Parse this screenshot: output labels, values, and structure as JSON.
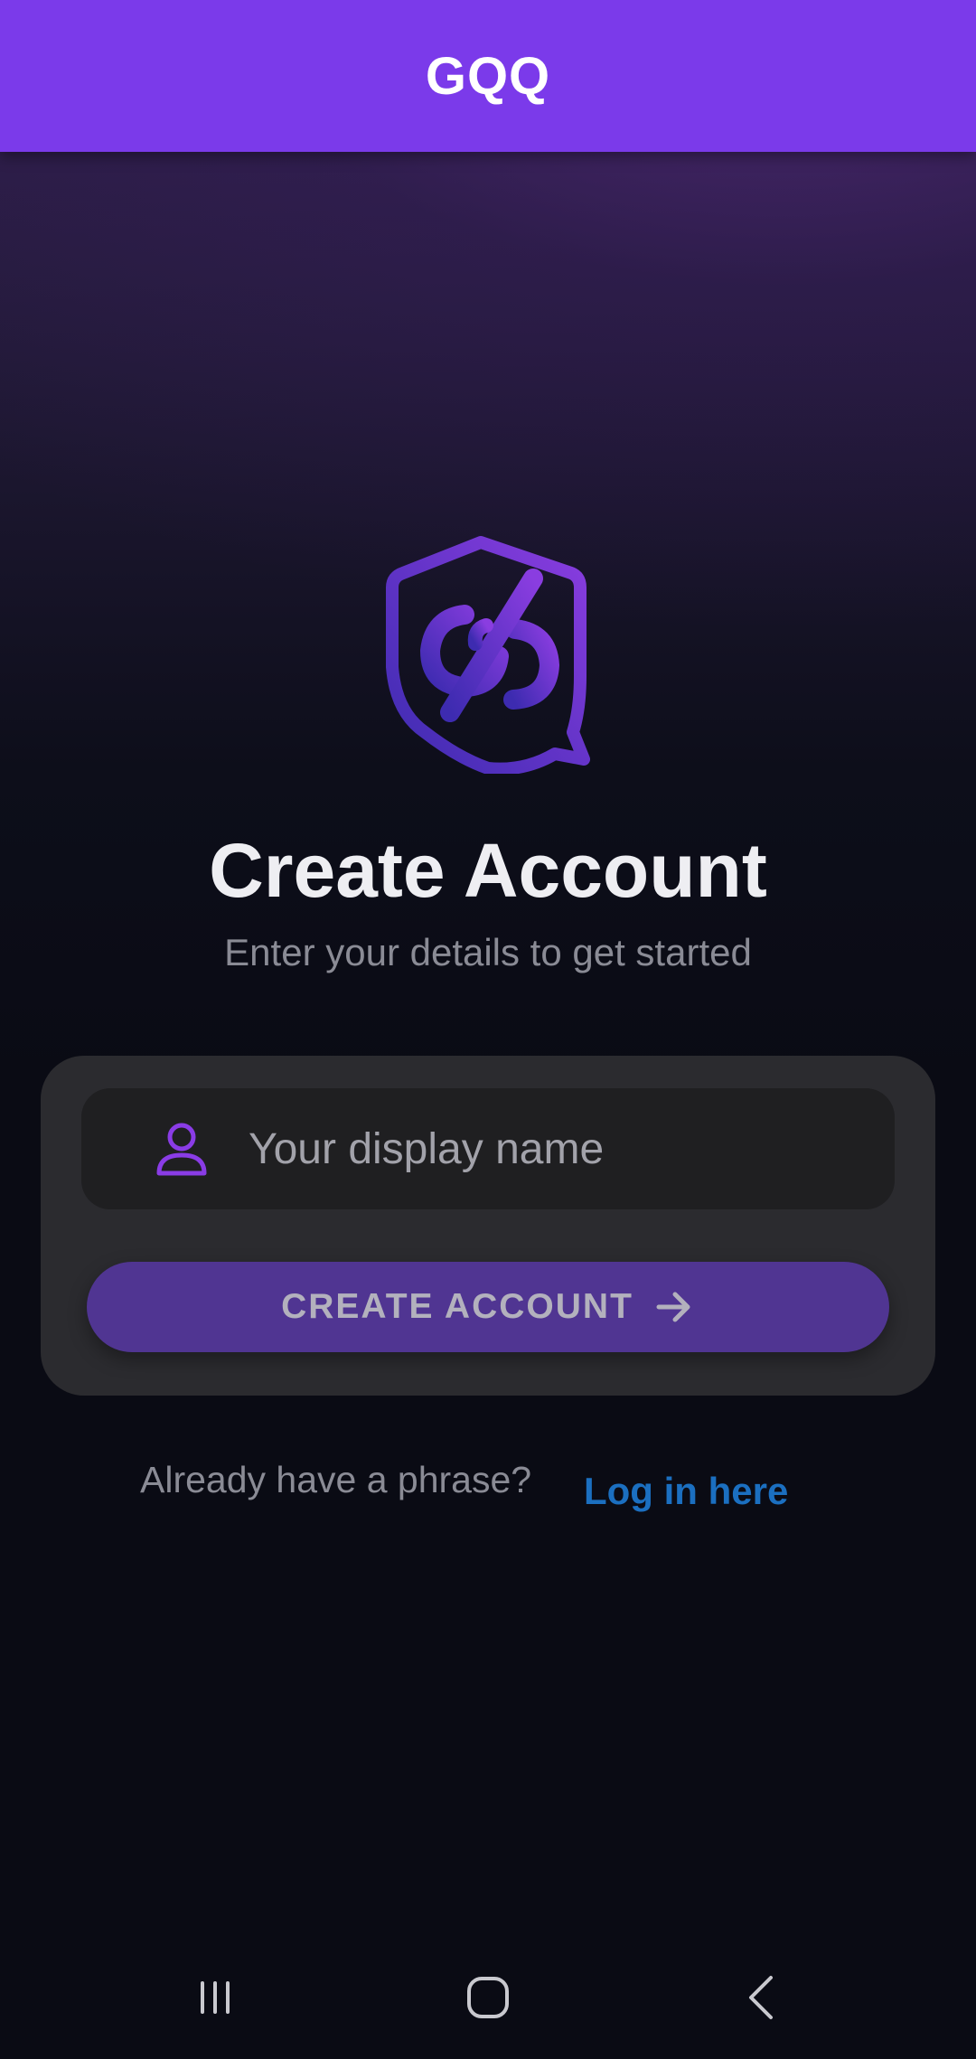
{
  "app_bar": {
    "title": "GQQ"
  },
  "colors": {
    "app_bar": "#7b3aea",
    "accent": "#7b3aea",
    "button": "#503592",
    "link": "#1b6fc0",
    "card": "#2b2b2f"
  },
  "logo": {
    "icon": "shield-chat-link-logo"
  },
  "header": {
    "title": "Create Account",
    "subtitle": "Enter your details to get started"
  },
  "form": {
    "name_field": {
      "icon": "person-icon",
      "value": "",
      "placeholder": "Your display name"
    },
    "submit": {
      "label": "CREATE ACCOUNT",
      "icon": "arrow-right-icon"
    }
  },
  "footer": {
    "prompt": "Already have a phrase?",
    "link": "Log in here"
  },
  "navigation_bar": {
    "buttons": [
      "recent-apps-icon",
      "home-icon",
      "back-icon"
    ]
  }
}
